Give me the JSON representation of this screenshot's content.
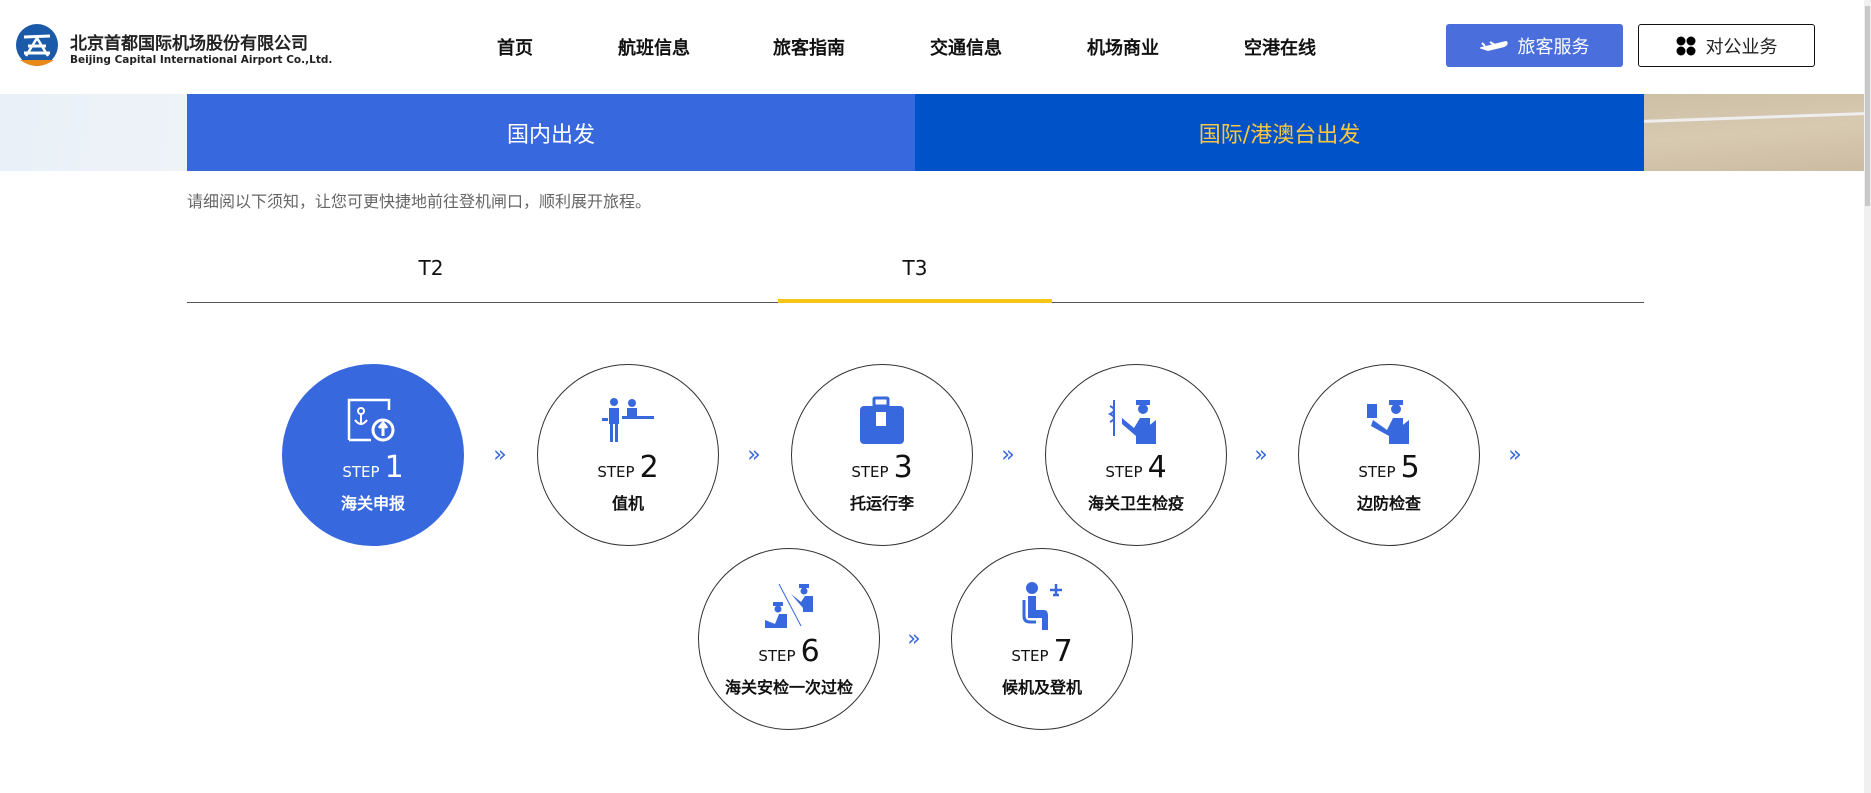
{
  "header": {
    "logo_cn": "北京首都国际机场股份有限公司",
    "logo_en": "Beijing Capital International Airport Co.,Ltd.",
    "nav": [
      "首页",
      "航班信息",
      "旅客指南",
      "交通信息",
      "机场商业",
      "空港在线"
    ],
    "passenger_btn": "旅客服务",
    "corporate_btn": "对公业务"
  },
  "departure_tabs": {
    "domestic": "国内出发",
    "international": "国际/港澳台出发",
    "active": "international"
  },
  "notice": "请细阅以下须知，让您可更快捷地前往登机闸口，顺利展开旅程。",
  "terminals": {
    "items": [
      "T2",
      "T3"
    ],
    "active": "T3"
  },
  "steps": {
    "label": "STEP",
    "active": 1,
    "items": [
      {
        "num": "1",
        "name": "海关申报",
        "icon": "customs-declaration-icon"
      },
      {
        "num": "2",
        "name": "值机",
        "icon": "check-in-icon"
      },
      {
        "num": "3",
        "name": "托运行李",
        "icon": "luggage-icon"
      },
      {
        "num": "4",
        "name": "海关卫生检疫",
        "icon": "health-quarantine-icon"
      },
      {
        "num": "5",
        "name": "边防检查",
        "icon": "border-check-icon"
      },
      {
        "num": "6",
        "name": "海关安检一次过检",
        "icon": "security-check-icon"
      },
      {
        "num": "7",
        "name": "候机及登机",
        "icon": "boarding-icon"
      }
    ]
  },
  "colors": {
    "primary": "#3868de",
    "dark_blue": "#0052c8",
    "yellow": "#f5c518"
  }
}
